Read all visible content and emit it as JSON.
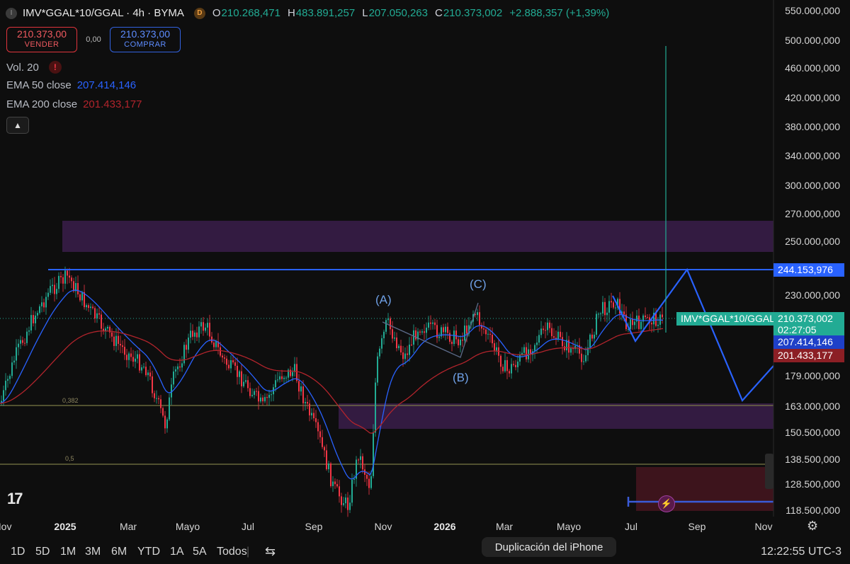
{
  "header": {
    "symbol_icon": "I",
    "title": "IMV*GGAL*10/GGAL · 4h · BYMA",
    "badge": "D",
    "ohlc": [
      {
        "label": "O",
        "value": "210.268,471"
      },
      {
        "label": "H",
        "value": "483.891,257"
      },
      {
        "label": "L",
        "value": "207.050,263"
      },
      {
        "label": "C",
        "value": "210.373,002"
      }
    ],
    "change": "+2.888,357 (+1,39%)"
  },
  "trade": {
    "sell_price": "210.373,00",
    "sell_label": "VENDER",
    "spread": "0,00",
    "buy_price": "210.373,00",
    "buy_label": "COMPRAR"
  },
  "indicators": {
    "vol_label": "Vol. 20",
    "vol_warning": "!",
    "ema50_label": "EMA 50 close",
    "ema50_value": "207.414,146",
    "ema200_label": "EMA 200 close",
    "ema200_value": "201.433,177",
    "collapse_icon": "chevron-up-icon"
  },
  "colors": {
    "bull": "#22ab94",
    "bear": "#f23645",
    "ema50": "#2962ff",
    "ema200": "#b2242c",
    "zone": "#4a1f58",
    "line": "#2962ff"
  },
  "price_labels": {
    "resistance": "244.153,976",
    "symbol_tag": "IMV*GGAL*10/GGAL",
    "last_price": "210.373,002",
    "countdown": "02:27:05",
    "ema50": "207.414,146",
    "ema200": "201.433,177"
  },
  "wave_labels": {
    "a": "(A)",
    "b": "(B)",
    "c": "(C)"
  },
  "fib_labels": {
    "f382": "0,382",
    "f05": "0,5"
  },
  "chart_data": {
    "type": "candlestick",
    "y_scale": "log",
    "y_ticks": [
      "550.000,000",
      "500.000,000",
      "460.000,000",
      "420.000,000",
      "380.000,000",
      "340.000,000",
      "300.000,000",
      "270.000,000",
      "250.000,000",
      "230.000,000",
      "179.000,000",
      "163.000,000",
      "150.500,000",
      "138.500,000",
      "128.500,000",
      "118.500,000"
    ],
    "x_ticks": [
      "Nov",
      "2025",
      "Mar",
      "Mayo",
      "Jul",
      "Sep",
      "Nov",
      "2026",
      "Mar",
      "Mayo",
      "Jul",
      "Sep",
      "Nov"
    ],
    "x_ticks_bold": [
      "2025",
      "2026"
    ],
    "last_price": 210373.002,
    "high_spike": 483891.257,
    "resistance": 244153.976,
    "ema50_last": 207414.146,
    "ema200_last": 201433.177
  },
  "timeframes": [
    "1D",
    "5D",
    "1M",
    "3M",
    "6M",
    "YTD",
    "1A",
    "5A",
    "Todos"
  ],
  "toast": "Duplicación del iPhone",
  "clock": "12:22:55 UTC-3",
  "logo": "17"
}
